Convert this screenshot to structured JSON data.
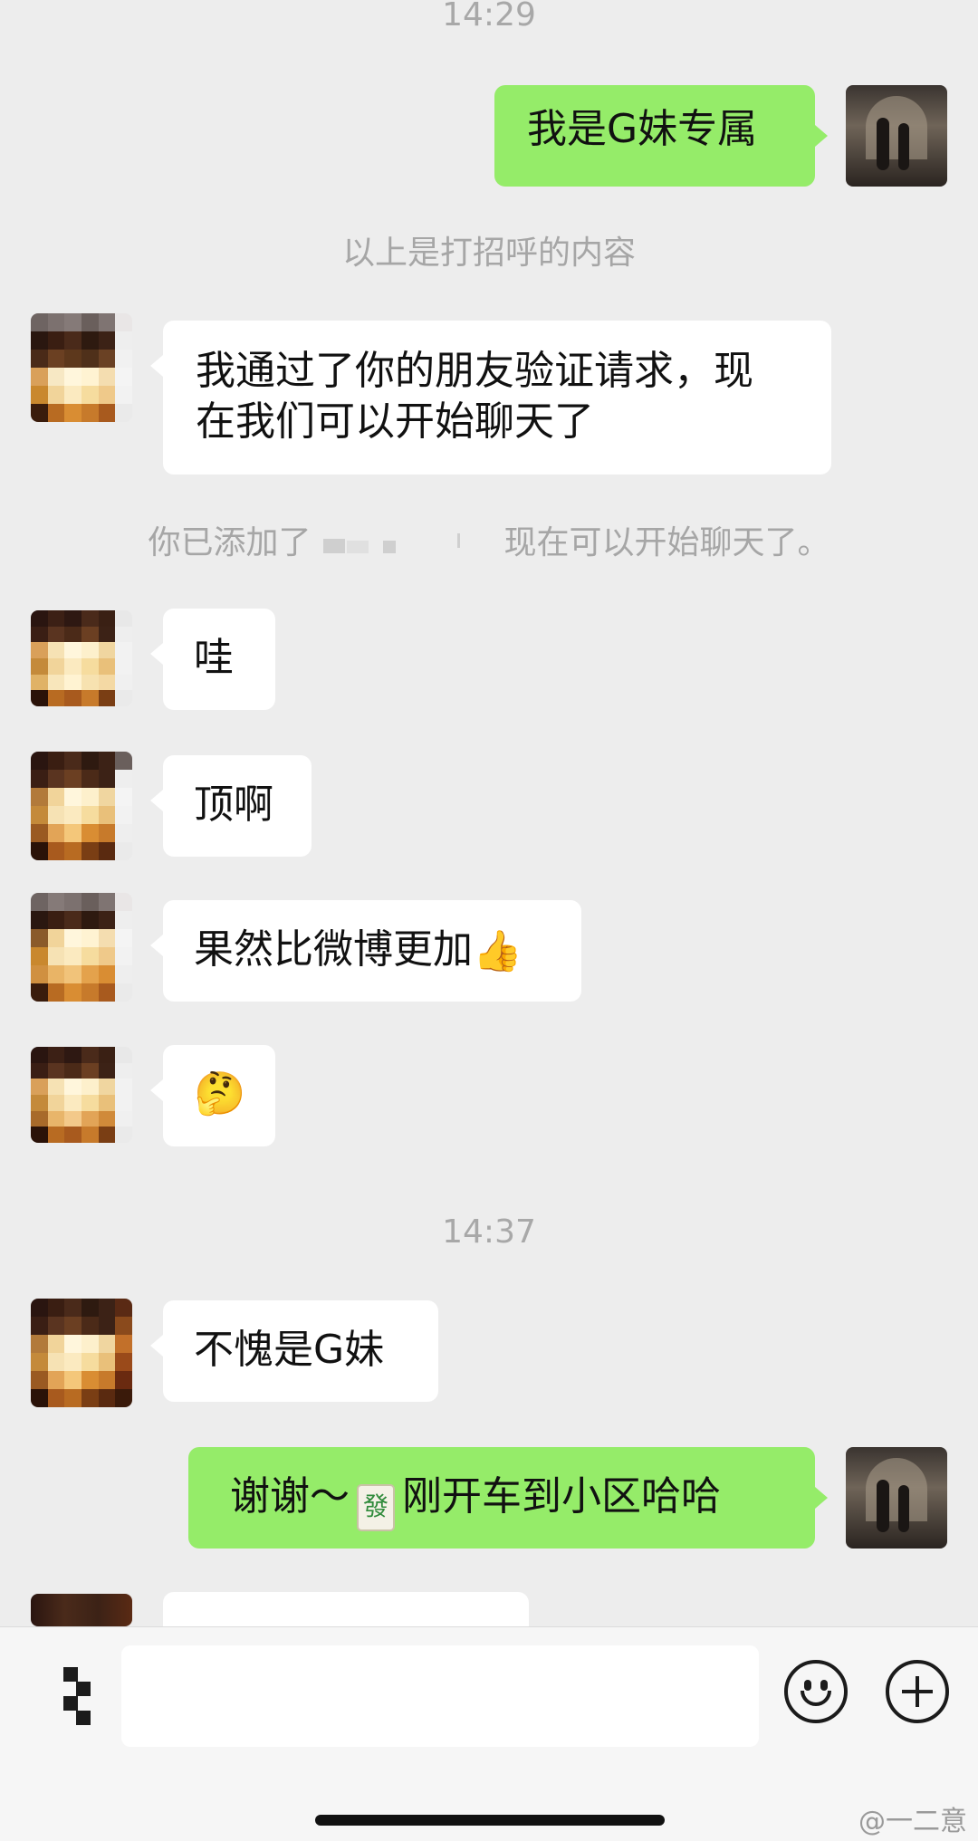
{
  "times": [
    "14:29",
    "14:37"
  ],
  "system_notices": {
    "greeting_above": "以上是打招呼的内容",
    "added_prefix": "你已添加了",
    "added_suffix": "现在可以开始聊天了。"
  },
  "messages": [
    {
      "from": "me",
      "text": "我是G妹专属"
    },
    {
      "from": "them",
      "line1": "我通过了你的朋友验证请求，现",
      "line2": "在我们可以开始聊天了"
    },
    {
      "from": "them",
      "text": "哇"
    },
    {
      "from": "them",
      "text": "顶啊"
    },
    {
      "from": "them",
      "text": "果然比微博更加",
      "emoji": "👍"
    },
    {
      "from": "them",
      "emoji": "🤔"
    },
    {
      "from": "them",
      "text": "不愧是G妹"
    },
    {
      "from": "me",
      "text_before": "谢谢～",
      "tile": "發",
      "text_after": "刚开车到小区哈哈"
    }
  ],
  "input": {
    "placeholder": ""
  },
  "icons": {
    "voice": "voice-icon",
    "emoji": "emoji-icon",
    "plus": "plus-icon"
  },
  "watermark": "@一二意",
  "colors": {
    "outgoing_bubble": "#95ec69",
    "incoming_bubble": "#ffffff",
    "background": "#ededed"
  }
}
